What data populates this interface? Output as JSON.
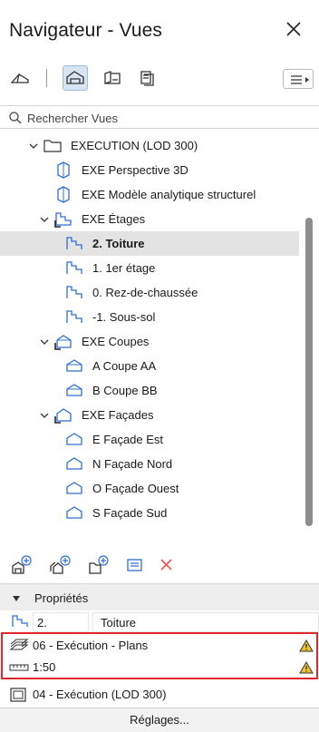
{
  "window": {
    "title": "Navigateur - Vues"
  },
  "search": {
    "placeholder": "Rechercher Vues"
  },
  "tree": {
    "items": [
      {
        "label": "EXECUTION (LOD 300)",
        "icon": "folder-icon",
        "expanded": true
      },
      {
        "label": "EXE Perspective 3D",
        "icon": "3d-view-icon"
      },
      {
        "label": "EXE Modèle analytique structurel",
        "icon": "3d-view-icon"
      },
      {
        "label": "EXE Étages",
        "icon": "story-folder-icon",
        "expanded": true
      },
      {
        "label": "2. Toiture",
        "icon": "story-icon",
        "selected": true
      },
      {
        "label": "1. 1er étage",
        "icon": "story-icon"
      },
      {
        "label": "0. Rez-de-chaussée",
        "icon": "story-icon"
      },
      {
        "label": "-1. Sous-sol",
        "icon": "story-icon"
      },
      {
        "label": "EXE Coupes",
        "icon": "section-folder-icon",
        "expanded": true
      },
      {
        "label": "A Coupe AA",
        "icon": "section-icon"
      },
      {
        "label": "B Coupe BB",
        "icon": "section-icon"
      },
      {
        "label": "EXE Façades",
        "icon": "elevation-folder-icon",
        "expanded": true
      },
      {
        "label": "E Façade Est",
        "icon": "elevation-icon"
      },
      {
        "label": "N Façade Nord",
        "icon": "elevation-icon"
      },
      {
        "label": "O Façade Ouest",
        "icon": "elevation-icon"
      },
      {
        "label": "S Façade Sud",
        "icon": "elevation-icon"
      }
    ]
  },
  "properties": {
    "header": "Propriétés",
    "id_value": "2.",
    "name_value": "Toiture",
    "layer_combination": "06 - Exécution - Plans",
    "scale": "1:50",
    "model_view_options": "04 - Exécution (LOD 300)"
  },
  "footer": {
    "settings_label": "Réglages..."
  },
  "colors": {
    "accent": "#2f6fd1",
    "highlight": "#e3262c",
    "warning": "#f1c232",
    "delete": "#ef5a5a"
  }
}
